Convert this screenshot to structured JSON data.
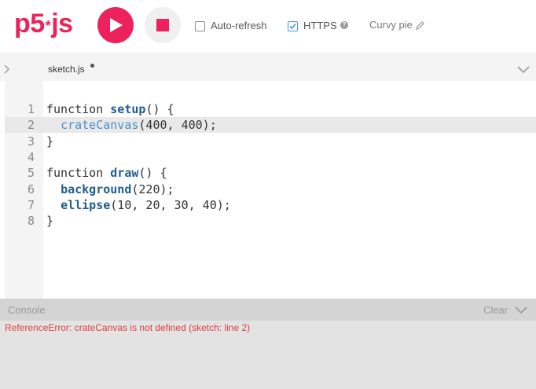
{
  "toolbar": {
    "logo_text": "p5",
    "logo_suffix": "js",
    "auto_refresh_label": "Auto-refresh",
    "auto_refresh_checked": false,
    "https_label": "HTTPS",
    "https_checked": true,
    "sketch_name": "Curvy pie"
  },
  "editor": {
    "tab_name": "sketch.js",
    "unsaved_dot": true,
    "active_line": 2,
    "lines": [
      {
        "n": "1",
        "tokens": [
          [
            "kw",
            "function "
          ],
          [
            "fn",
            "setup"
          ],
          [
            "kw",
            "() {"
          ]
        ]
      },
      {
        "n": "2",
        "tokens": [
          [
            "kw",
            "  "
          ],
          [
            "err",
            "crateCanvas"
          ],
          [
            "kw",
            "(400, 400);"
          ]
        ]
      },
      {
        "n": "3",
        "tokens": [
          [
            "kw",
            "}"
          ]
        ]
      },
      {
        "n": "4",
        "tokens": []
      },
      {
        "n": "5",
        "tokens": [
          [
            "kw",
            "function "
          ],
          [
            "fn",
            "draw"
          ],
          [
            "kw",
            "() {"
          ]
        ]
      },
      {
        "n": "6",
        "tokens": [
          [
            "kw",
            "  "
          ],
          [
            "fn",
            "background"
          ],
          [
            "kw",
            "(220);"
          ]
        ]
      },
      {
        "n": "7",
        "tokens": [
          [
            "kw",
            "  "
          ],
          [
            "fn",
            "ellipse"
          ],
          [
            "kw",
            "(10, 20, 30, 40);"
          ]
        ]
      },
      {
        "n": "8",
        "tokens": [
          [
            "kw",
            "}"
          ]
        ]
      }
    ]
  },
  "console": {
    "title": "Console",
    "clear_label": "Clear",
    "message": "ReferenceError: crateCanvas is not defined (sketch: line 2)"
  },
  "colors": {
    "accent": "#ED225D",
    "error_text": "#e03d3d",
    "function_name": "#1f5d8f"
  }
}
